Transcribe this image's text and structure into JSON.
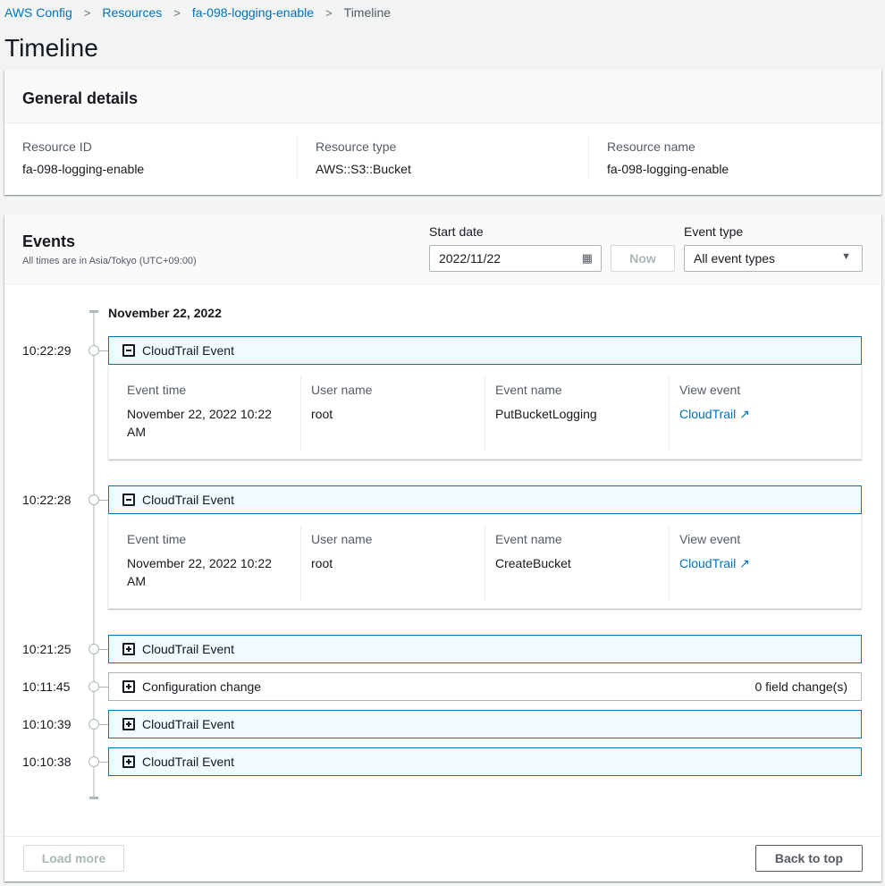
{
  "breadcrumb": [
    "AWS Config",
    "Resources",
    "fa-098-logging-enable",
    "Timeline"
  ],
  "page_title": "Timeline",
  "general": {
    "title": "General details",
    "fields": [
      {
        "label": "Resource ID",
        "value": "fa-098-logging-enable"
      },
      {
        "label": "Resource type",
        "value": "AWS::S3::Bucket"
      },
      {
        "label": "Resource name",
        "value": "fa-098-logging-enable"
      }
    ]
  },
  "events": {
    "title": "Events",
    "timezone": "All times are in Asia/Tokyo (UTC+09:00)",
    "start_date_label": "Start date",
    "start_date": "2022/11/22",
    "now_label": "Now",
    "event_type_label": "Event type",
    "event_type": "All event types",
    "date_heading": "November 22, 2022",
    "col_labels": {
      "time": "Event time",
      "user": "User name",
      "name": "Event name",
      "view": "View event"
    },
    "items": [
      {
        "time": "10:22:29",
        "title": "CloudTrail Event",
        "expanded": true,
        "event_time": "November 22, 2022 10:22 AM",
        "user": "root",
        "event_name": "PutBucketLogging",
        "link": "CloudTrail"
      },
      {
        "time": "10:22:28",
        "title": "CloudTrail Event",
        "expanded": true,
        "event_time": "November 22, 2022 10:22 AM",
        "user": "root",
        "event_name": "CreateBucket",
        "link": "CloudTrail"
      },
      {
        "time": "10:21:25",
        "title": "CloudTrail Event",
        "expanded": false
      },
      {
        "time": "10:11:45",
        "title": "Configuration change",
        "expanded": false,
        "extra": "0 field change(s)"
      },
      {
        "time": "10:10:39",
        "title": "CloudTrail Event",
        "expanded": false
      },
      {
        "time": "10:10:38",
        "title": "CloudTrail Event",
        "expanded": false
      }
    ],
    "load_more": "Load more",
    "back_to_top": "Back to top"
  },
  "colors": {
    "link": "#0073bb",
    "background": "#f2f3f3"
  }
}
